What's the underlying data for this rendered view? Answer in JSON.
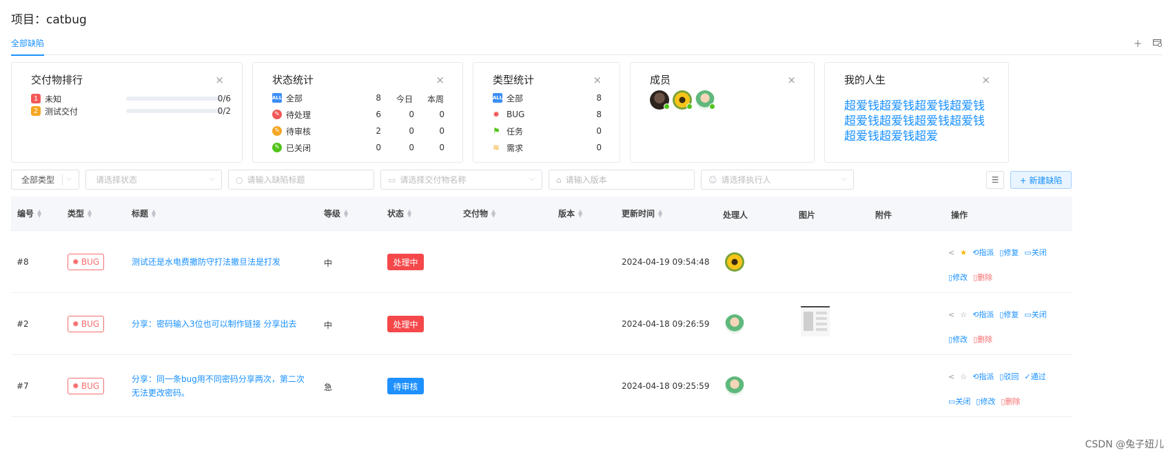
{
  "project": {
    "title": "项目：catbug"
  },
  "tabs": {
    "active": "全部缺陷"
  },
  "cards": {
    "deliverable": {
      "title": "交付物排行",
      "close": "×",
      "items": [
        {
          "rank": "1",
          "name": "未知",
          "fraction": "0/6",
          "progress": 0
        },
        {
          "rank": "2",
          "name": "测试交付",
          "fraction": "0/2",
          "progress": 0
        }
      ]
    },
    "status": {
      "title": "状态统计",
      "close": "×",
      "col_today": "今日",
      "col_week": "本周",
      "rows": [
        {
          "icon_label": "ALL",
          "label": "全部",
          "total": "8",
          "today": "",
          "week": ""
        },
        {
          "icon_label": "✎",
          "label": "待处理",
          "total": "6",
          "today": "0",
          "week": "0"
        },
        {
          "icon_label": "✎",
          "label": "待审核",
          "total": "2",
          "today": "0",
          "week": "0"
        },
        {
          "icon_label": "✎",
          "label": "已关闭",
          "total": "0",
          "today": "0",
          "week": "0"
        }
      ]
    },
    "types": {
      "title": "类型统计",
      "close": "×",
      "rows": [
        {
          "icon_label": "ALL",
          "label": "全部",
          "count": "8"
        },
        {
          "icon_label": "bug-icon",
          "label": "BUG",
          "count": "8"
        },
        {
          "icon_label": "flag-icon",
          "label": "任务",
          "count": "0"
        },
        {
          "icon_label": "demand-icon",
          "label": "需求",
          "count": "0"
        }
      ]
    },
    "members": {
      "title": "成员",
      "close": "×"
    },
    "life": {
      "title": "我的人生",
      "close": "×",
      "text": "超爱钱超爱钱超爱钱超爱钱超爱钱超爱钱超爱钱超爱钱超爱钱超爱钱超爱"
    }
  },
  "filters": {
    "type": "全部类型",
    "status_placeholder": "请选择状态",
    "title_placeholder": "请输入缺陷标题",
    "deliverable_placeholder": "请选择交付物名称",
    "version_placeholder": "请输入版本",
    "assignee_placeholder": "请选择执行人",
    "new_button": "+ 新建缺陷"
  },
  "table": {
    "headers": {
      "id": "编号",
      "type": "类型",
      "title": "标题",
      "level": "等级",
      "status": "状态",
      "deliverable": "交付物",
      "version": "版本",
      "updated": "更新时间",
      "handler": "处理人",
      "image": "图片",
      "attachment": "附件",
      "ops": "操作"
    },
    "rows": [
      {
        "id": "#8",
        "type": "BUG",
        "title": "测试还是水电费撤防守打法撤旦法是打发",
        "level": "中",
        "status": "处理中",
        "status_color": "#f5484a",
        "updated": "2024-04-19 09:54:48",
        "ops_line1": [
          "指派",
          "修复",
          "关闭"
        ],
        "ops_line2": [
          "修改",
          "删除"
        ]
      },
      {
        "id": "#2",
        "type": "BUG",
        "title": "分享：密码输入3位也可以制作链接 分享出去",
        "level": "中",
        "status": "处理中",
        "status_color": "#f5484a",
        "updated": "2024-04-18 09:26:59",
        "ops_line1": [
          "指派",
          "修复",
          "关闭"
        ],
        "ops_line2": [
          "修改",
          "删除"
        ]
      },
      {
        "id": "#7",
        "type": "BUG",
        "title": "分享：同一条bug用不同密码分享两次，第二次无法更改密码。",
        "level": "急",
        "status": "待审核",
        "status_color": "#1e90ff",
        "updated": "2024-04-18 09:25:59",
        "ops_line1": [
          "指派",
          "驳回",
          "通过"
        ],
        "ops_line2": [
          "关闭",
          "修改",
          "删除"
        ]
      }
    ]
  },
  "watermark": "CSDN @兔子妞儿",
  "colors": {
    "accent": "#1890ff",
    "danger": "#f56c6c"
  }
}
